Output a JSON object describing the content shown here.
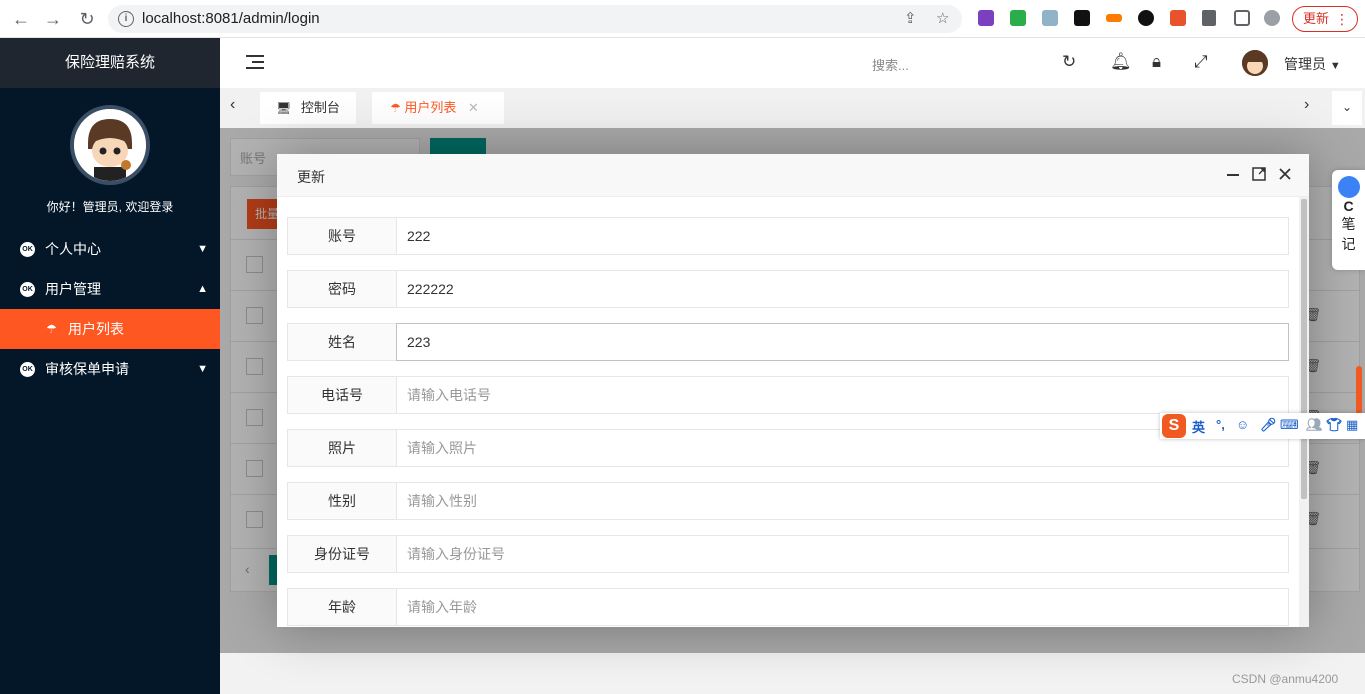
{
  "browser": {
    "url": "localhost:8081/admin/login",
    "update_label": "更新"
  },
  "sidebar": {
    "system_title": "保险理赔系统",
    "welcome": "你好！管理员, 欢迎登录",
    "menu": [
      {
        "label": "个人中心",
        "icon": "ok-icon",
        "expanded": false
      },
      {
        "label": "用户管理",
        "icon": "ok-icon",
        "expanded": true
      },
      {
        "label": "用户列表",
        "icon": "sub-icon",
        "active": true
      },
      {
        "label": "审核保单申请",
        "icon": "ok-icon",
        "expanded": false
      }
    ]
  },
  "header": {
    "search_placeholder": "搜索...",
    "user_name": "管理员"
  },
  "tabs": [
    {
      "label": "控制台",
      "icon": "monitor-icon",
      "active": false
    },
    {
      "label": "用户列表",
      "icon": "sub-icon",
      "active": true
    }
  ],
  "background": {
    "search_placeholder": "账号",
    "batch_delete_label": "批量"
  },
  "modal": {
    "title": "更新",
    "fields": [
      {
        "label": "账号",
        "value": "222",
        "placeholder": ""
      },
      {
        "label": "密码",
        "value": "222222",
        "placeholder": ""
      },
      {
        "label": "姓名",
        "value": "223",
        "placeholder": ""
      },
      {
        "label": "电话号",
        "value": "",
        "placeholder": "请输入电话号"
      },
      {
        "label": "照片",
        "value": "",
        "placeholder": "请输入照片"
      },
      {
        "label": "性别",
        "value": "",
        "placeholder": "请输入性别"
      },
      {
        "label": "身份证号",
        "value": "",
        "placeholder": "请输入身份证号"
      },
      {
        "label": "年龄",
        "value": "",
        "placeholder": "请输入年龄"
      }
    ]
  },
  "widgets": {
    "note_letter": "C",
    "note_text_1": "笔",
    "note_text_2": "记",
    "ime_lang": "英"
  },
  "watermark": "CSDN @anmu4200",
  "colors": {
    "sidebar_bg": "#031729",
    "accent": "#ff5722",
    "teal": "#009688"
  }
}
